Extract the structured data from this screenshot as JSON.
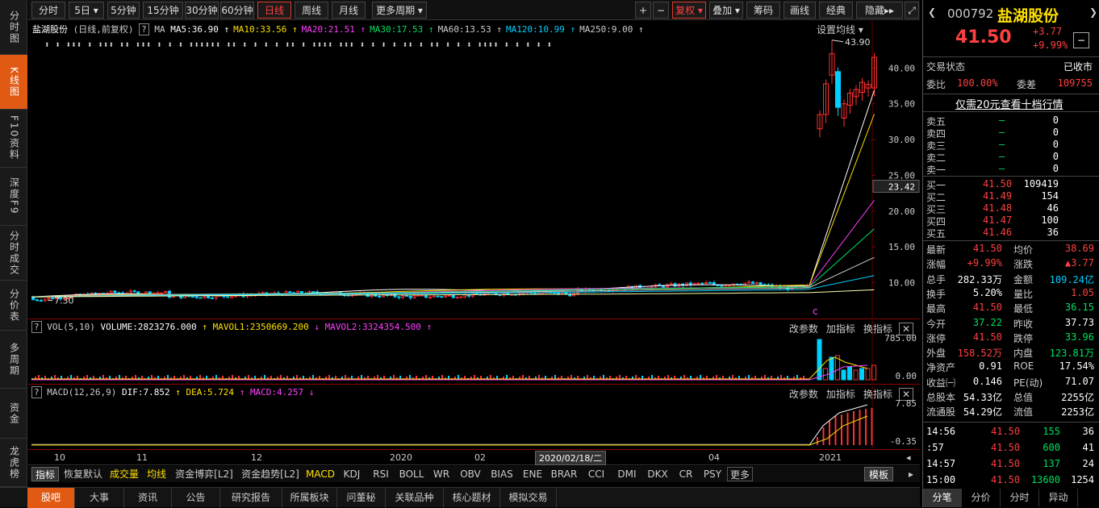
{
  "left_nav": [
    "分时图",
    "K线图",
    "F10资料",
    "深度F9",
    "分时成交",
    "分价表",
    "多周期",
    "资金",
    "龙虎榜"
  ],
  "left_nav_active": 1,
  "toolbar": {
    "periods": [
      "分时",
      "5日",
      "5分钟",
      "15分钟",
      "30分钟",
      "60分钟",
      "日线",
      "周线",
      "月线",
      "更多周期"
    ],
    "active_period": "日线",
    "right": [
      "+",
      "−",
      "复权",
      "叠加",
      "筹码",
      "画线",
      "经典",
      "隐藏▸▸"
    ]
  },
  "chart_info": {
    "stock": "盐湖股份",
    "mode": "(日线,前复权)",
    "help": "?",
    "ma_label": "MA",
    "ma": [
      {
        "text": "MA5:36.90",
        "color": "#ffffff",
        "arrow": "↑"
      },
      {
        "text": "MA10:33.56",
        "color": "#ffe000",
        "arrow": "↑"
      },
      {
        "text": "MA20:21.51",
        "color": "#ff40ff",
        "arrow": "↑"
      },
      {
        "text": "MA30:17.53",
        "color": "#00e060",
        "arrow": "↑"
      },
      {
        "text": "MA60:13.53",
        "color": "#cccccc",
        "arrow": "↑"
      },
      {
        "text": "MA120:10.99",
        "color": "#00d0ff",
        "arrow": "↑"
      },
      {
        "text": "MA250:9.00",
        "color": "#cccccc",
        "arrow": "↑"
      }
    ],
    "setting": "设置均线",
    "max_label": "43.90",
    "min_label": "7.30",
    "cursor_price": "23.42",
    "marker": "c"
  },
  "price_axis": [
    "40.00",
    "35.00",
    "30.00",
    "25.00",
    "20.00",
    "15.00",
    "10.00"
  ],
  "vol_panel": {
    "title": "VOL(5,10)",
    "volume": "VOLUME:2823276.000",
    "mavol1": "MAVOL1:2350669.200",
    "mavol2": "MAVOL2:3324354.500",
    "buttons": [
      "改参数",
      "加指标",
      "换指标"
    ],
    "axis": [
      "785.00",
      "0.00"
    ]
  },
  "macd_panel": {
    "title": "MACD(12,26,9)",
    "dif": "DIF:7.852",
    "dea": "DEA:5.724",
    "macd": "MACD:4.257",
    "buttons": [
      "改参数",
      "加指标",
      "换指标"
    ],
    "axis": [
      "7.85",
      "-0.35"
    ]
  },
  "x_axis": [
    "10",
    "11",
    "12",
    "2020",
    "02",
    "2020/02/18/二",
    "04",
    "2021"
  ],
  "indicator_bar": [
    "指标",
    "恢复默认",
    "成交量",
    "均线",
    "资金博弈[L2]",
    "资金趋势[L2]",
    "MACD",
    "KDJ",
    "RSI",
    "BOLL",
    "WR",
    "OBV",
    "BIAS",
    "ENE",
    "BRAR",
    "CCI",
    "DMI",
    "DKX",
    "CR",
    "PSY",
    "更多",
    "模板"
  ],
  "bottom_tabs": [
    "股吧",
    "大事",
    "资讯",
    "公告",
    "研究报告",
    "所属板块",
    "问董秘",
    "关联品种",
    "核心题材",
    "模拟交易"
  ],
  "quote": {
    "code": "000792",
    "name": "盐湖股份",
    "price": "41.50",
    "change": "+3.77",
    "change_pct": "+9.99%",
    "status_label": "交易状态",
    "status": "已收市",
    "weibi_label": "委比",
    "weibi": "100.00%",
    "weicha_label": "委差",
    "weicha": "109755",
    "ten_level": "仅需20元查看十档行情",
    "sells": [
      {
        "label": "卖五",
        "price": "—",
        "vol": "0"
      },
      {
        "label": "卖四",
        "price": "—",
        "vol": "0"
      },
      {
        "label": "卖三",
        "price": "—",
        "vol": "0"
      },
      {
        "label": "卖二",
        "price": "—",
        "vol": "0"
      },
      {
        "label": "卖一",
        "price": "—",
        "vol": "0"
      }
    ],
    "buys": [
      {
        "label": "买一",
        "price": "41.50",
        "vol": "109419"
      },
      {
        "label": "买二",
        "price": "41.49",
        "vol": "154"
      },
      {
        "label": "买三",
        "price": "41.48",
        "vol": "46"
      },
      {
        "label": "买四",
        "price": "41.47",
        "vol": "100"
      },
      {
        "label": "买五",
        "price": "41.46",
        "vol": "36"
      }
    ],
    "stats": [
      {
        "l1": "最新",
        "v1": "41.50",
        "c1": "red",
        "l2": "均价",
        "v2": "38.69",
        "c2": "red"
      },
      {
        "l1": "涨幅",
        "v1": "+9.99%",
        "c1": "red",
        "l2": "涨跌",
        "v2": "▲3.77",
        "c2": "red"
      },
      {
        "l1": "总手",
        "v1": "282.33万",
        "c1": "white",
        "l2": "金额",
        "v2": "109.24亿",
        "c2": "cyan"
      },
      {
        "l1": "换手",
        "v1": "5.20%",
        "c1": "white",
        "l2": "量比",
        "v2": "1.05",
        "c2": "red"
      },
      {
        "l1": "最高",
        "v1": "41.50",
        "c1": "red",
        "l2": "最低",
        "v2": "36.15",
        "c2": "green"
      },
      {
        "l1": "今开",
        "v1": "37.22",
        "c1": "green",
        "l2": "昨收",
        "v2": "37.73",
        "c2": "white"
      },
      {
        "l1": "涨停",
        "v1": "41.50",
        "c1": "red",
        "l2": "跌停",
        "v2": "33.96",
        "c2": "green"
      },
      {
        "l1": "外盘",
        "v1": "158.52万",
        "c1": "red",
        "l2": "内盘",
        "v2": "123.81万",
        "c2": "green"
      },
      {
        "l1": "净资产",
        "v1": "0.91",
        "c1": "white",
        "l2": "ROE",
        "v2": "17.54%",
        "c2": "white"
      },
      {
        "l1": "收益㈠",
        "v1": "0.146",
        "c1": "white",
        "l2": "PE(动)",
        "v2": "71.07",
        "c2": "white"
      },
      {
        "l1": "总股本",
        "v1": "54.33亿",
        "c1": "white",
        "l2": "总值",
        "v2": "2255亿",
        "c2": "white"
      },
      {
        "l1": "流通股",
        "v1": "54.29亿",
        "c1": "white",
        "l2": "流值",
        "v2": "2253亿",
        "c2": "white"
      }
    ],
    "ticks": [
      {
        "time": "14:56",
        "price": "41.50",
        "vol": "155",
        "n": "36"
      },
      {
        "time": ":57",
        "price": "41.50",
        "vol": "600",
        "n": "41"
      },
      {
        "time": "14:57",
        "price": "41.50",
        "vol": "137",
        "n": "24"
      },
      {
        "time": "15:00",
        "price": "41.50",
        "vol": "13600",
        "n": "1254"
      }
    ],
    "tabs": [
      "分笔",
      "分价",
      "分时",
      "异动"
    ]
  },
  "chart_data": {
    "type": "candlestick",
    "title": "盐湖股份 (日线,前复权)",
    "y_ticks": [
      10,
      15,
      20,
      25,
      30,
      35,
      40
    ],
    "ylim": [
      6,
      45
    ],
    "x_labels": [
      "10",
      "11",
      "12",
      "2020",
      "02",
      "04",
      "2021"
    ],
    "high": 43.9,
    "low": 7.3,
    "last_close": 41.5,
    "ma": {
      "MA5": 36.9,
      "MA10": 33.56,
      "MA20": 21.51,
      "MA30": 17.53,
      "MA60": 13.53,
      "MA120": 10.99,
      "MA250": 9.0
    },
    "recent_closes": [
      33.5,
      37.8,
      42.0,
      34.5,
      35.0,
      36.5,
      37.0,
      38.0,
      37.7,
      41.5
    ]
  }
}
